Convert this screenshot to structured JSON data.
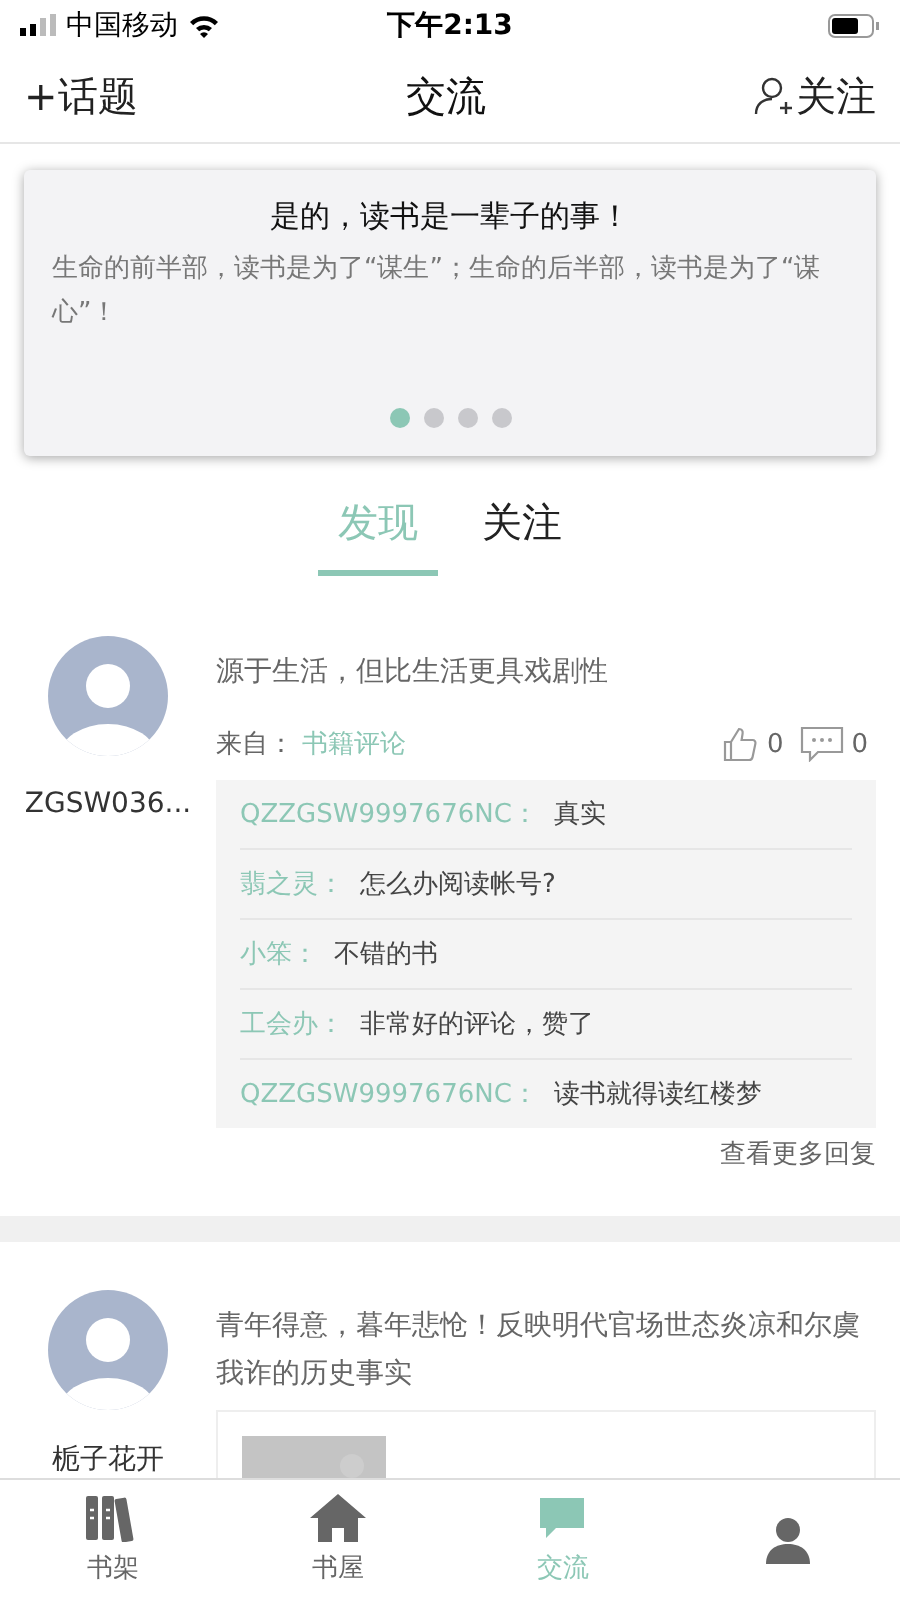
{
  "status_bar": {
    "carrier": "中国移动",
    "time": "下午2:13"
  },
  "header": {
    "left": "+话题",
    "title": "交流",
    "right": "关注"
  },
  "banner": {
    "title": "是的，读书是一辈子的事！",
    "text": "生命的前半部，读书是为了“谋生”；生命的后半部，读书是为了“谋心”！",
    "dots": [
      {
        "selected": true
      },
      {
        "selected": false
      },
      {
        "selected": false
      },
      {
        "selected": false
      }
    ]
  },
  "tabs": [
    {
      "label": "发现",
      "selected": true
    },
    {
      "label": "关注",
      "selected": false
    }
  ],
  "posts": [
    {
      "user": "ZGSW036...",
      "text": "源于生活，但比生活更具戏剧性",
      "source_label": "来自：",
      "source": "书籍评论",
      "likes": "0",
      "comments": "0",
      "replies": [
        {
          "user": "QZZGSW9997676NC：",
          "text": "真实"
        },
        {
          "user": "翡之灵：",
          "text": "怎么办阅读帐号?"
        },
        {
          "user": "小笨：",
          "text": "不错的书"
        },
        {
          "user": "工会办：",
          "text": "非常好的评论，赞了"
        },
        {
          "user": "QZZGSW9997676NC：",
          "text": "读书就得读红楼梦"
        }
      ],
      "more": "查看更多回复"
    },
    {
      "user": "栀子花开",
      "text": "青年得意，暮年悲怆！反映明代官场世态炎凉和尔虞我诈的历史事实"
    }
  ],
  "nav": [
    {
      "label": "书架",
      "kind": "shelf",
      "selected": false
    },
    {
      "label": "书屋",
      "kind": "home",
      "selected": false
    },
    {
      "label": "交流",
      "kind": "chat",
      "selected": true
    },
    {
      "kind": "person",
      "selected": false
    }
  ]
}
